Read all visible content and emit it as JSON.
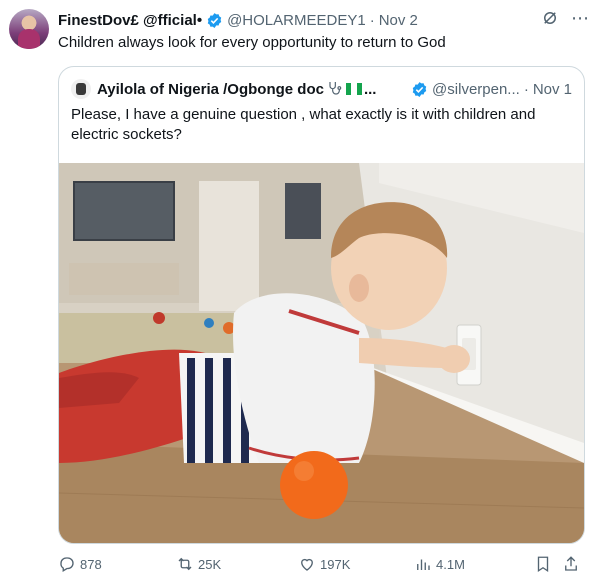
{
  "author": {
    "display_name": "FinestDov£ @fficial•",
    "handle": "@HOLARMEEDEY1",
    "separator": "·",
    "date": "Nov 2"
  },
  "tweet_text": "Children always look for every opportunity to return to God",
  "quoted": {
    "display_name": "Ayilola of Nigeria /Ogbonge doc",
    "ellipsis": "...",
    "handle": "@silverpen...",
    "separator": "·",
    "date": "Nov 1",
    "text": "Please, I have a genuine question , what exactly is it with children and electric sockets?"
  },
  "actions": {
    "replies": "878",
    "reposts": "25K",
    "likes": "197K",
    "views": "4.1M"
  },
  "icons": [
    "verified-badge-icon",
    "grok-icon",
    "more-icon",
    "stethoscope-icon",
    "nigeria-flag-icon",
    "reply-icon",
    "repost-icon",
    "like-icon",
    "views-icon",
    "bookmark-icon",
    "share-icon"
  ],
  "colors": {
    "verified": "#1d9bf0",
    "secondary_text": "#536471",
    "border": "#cfd9de"
  }
}
